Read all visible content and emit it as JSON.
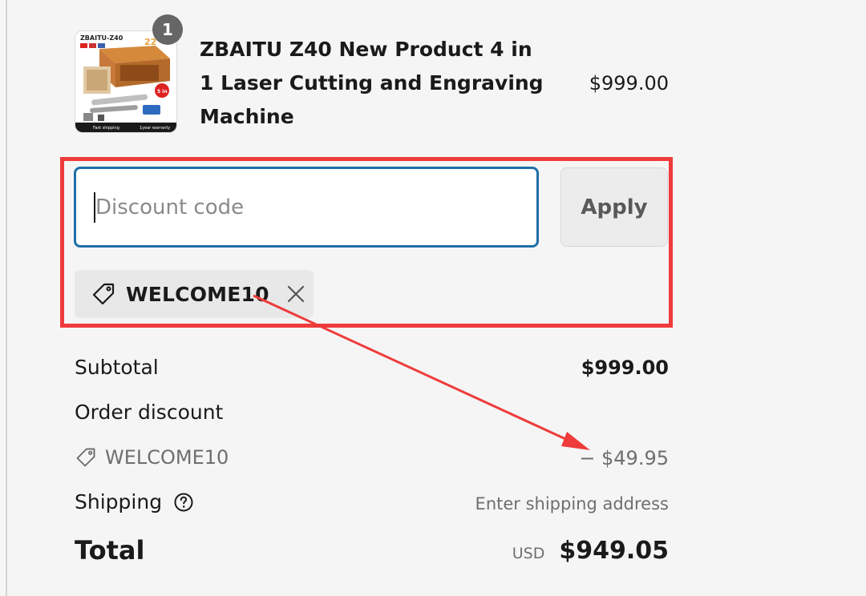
{
  "product": {
    "title": "ZBAITU Z40 New Product 4 in 1 Laser Cutting and Engraving Machine",
    "price": "$999.00",
    "quantity": "1",
    "image_text": {
      "brand": "ZBAITU-Z40",
      "badge": "5 in 1",
      "footer_left": "Fast shipping",
      "footer_right": "1year warranty"
    }
  },
  "discount": {
    "placeholder": "Discount code",
    "value": "",
    "apply_label": "Apply",
    "applied_code": "WELCOME10"
  },
  "summary": {
    "subtotal_label": "Subtotal",
    "subtotal_value": "$999.00",
    "order_discount_label": "Order discount",
    "discount_code": "WELCOME10",
    "discount_value": "− $49.95",
    "shipping_label": "Shipping",
    "shipping_value": "Enter shipping address",
    "total_label": "Total",
    "total_currency": "USD",
    "total_value": "$949.05"
  },
  "icons": {
    "tag": "tag-icon",
    "remove": "close-icon",
    "help": "question-circle-icon"
  },
  "colors": {
    "annotation": "#ef3b3b",
    "input_focus": "#1f6fa8",
    "background": "#f5f5f5"
  }
}
